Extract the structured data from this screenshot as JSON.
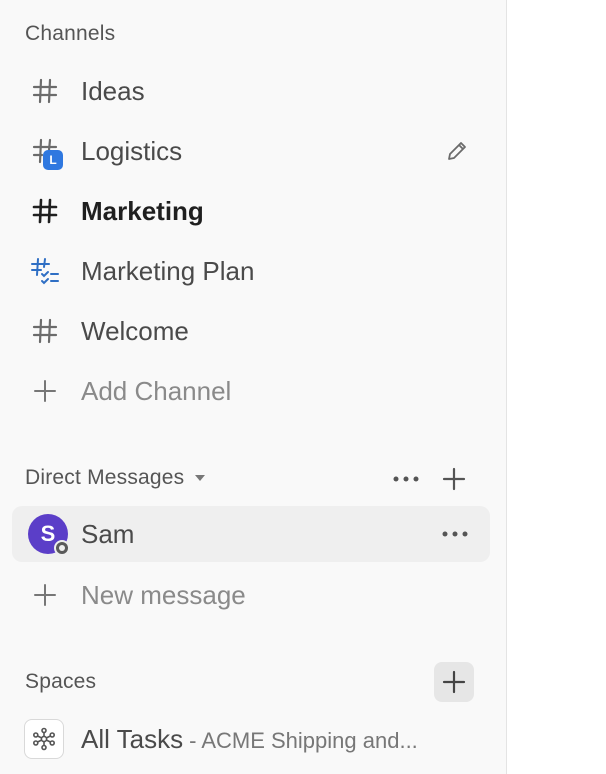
{
  "channels": {
    "title": "Channels",
    "items": [
      {
        "label": "Ideas"
      },
      {
        "label": "Logistics",
        "badge": "L"
      },
      {
        "label": "Marketing"
      },
      {
        "label": "Marketing Plan"
      },
      {
        "label": "Welcome"
      }
    ],
    "add_label": "Add Channel"
  },
  "direct_messages": {
    "title": "Direct Messages",
    "items": [
      {
        "label": "Sam",
        "initial": "S"
      }
    ],
    "new_label": "New message"
  },
  "spaces": {
    "title": "Spaces",
    "items": [
      {
        "label": "All Tasks",
        "suffix": "- ACME Shipping and..."
      }
    ]
  },
  "colors": {
    "badge": "#2f78e0",
    "avatar": "#5b3ec8",
    "sidebar_bg": "#f9f9f9",
    "active_row": "#efefef"
  }
}
